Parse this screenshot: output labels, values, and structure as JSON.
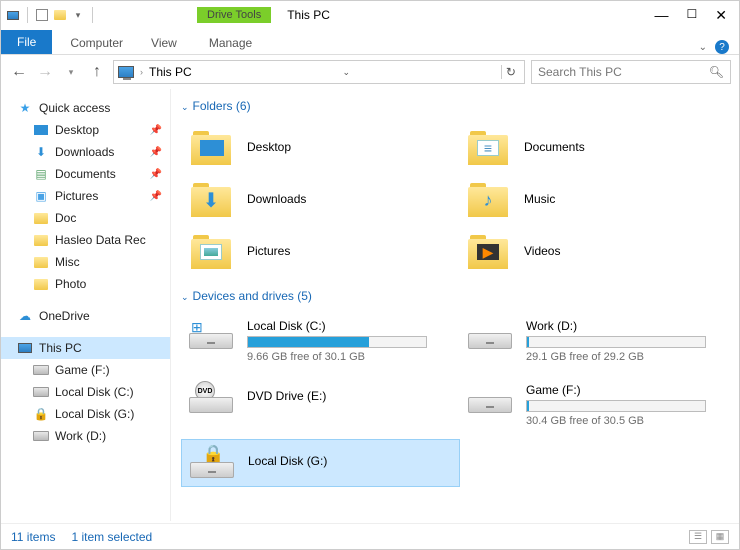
{
  "window": {
    "context_tab": "Drive Tools",
    "title": "This PC"
  },
  "ribbon": {
    "file": "File",
    "tabs": [
      "Computer",
      "View",
      "Manage"
    ]
  },
  "address": {
    "path": "This PC",
    "search_placeholder": "Search This PC"
  },
  "sidebar": {
    "quick_access": "Quick access",
    "pinned": [
      {
        "label": "Desktop"
      },
      {
        "label": "Downloads"
      },
      {
        "label": "Documents"
      },
      {
        "label": "Pictures"
      }
    ],
    "folders": [
      "Doc",
      "Hasleo Data Rec",
      "Misc",
      "Photo"
    ],
    "onedrive": "OneDrive",
    "this_pc": "This PC",
    "drives": [
      "Game (F:)",
      "Local Disk (C:)",
      "Local Disk (G:)",
      "Work (D:)"
    ]
  },
  "sections": {
    "folders_head": "Folders (6)",
    "drives_head": "Devices and drives (5)"
  },
  "folders": [
    {
      "label": "Desktop"
    },
    {
      "label": "Documents"
    },
    {
      "label": "Downloads"
    },
    {
      "label": "Music"
    },
    {
      "label": "Pictures"
    },
    {
      "label": "Videos"
    }
  ],
  "drives_list": [
    {
      "label": "Local Disk (C:)",
      "free": "9.66 GB free of 30.1 GB",
      "pct": 68
    },
    {
      "label": "Work (D:)",
      "free": "29.1 GB free of 29.2 GB",
      "pct": 1
    },
    {
      "label": "DVD Drive (E:)",
      "free": "",
      "pct": null
    },
    {
      "label": "Game (F:)",
      "free": "30.4 GB free of 30.5 GB",
      "pct": 1
    },
    {
      "label": "Local Disk (G:)",
      "free": "",
      "pct": null
    }
  ],
  "status": {
    "count": "11 items",
    "selected": "1 item selected"
  }
}
